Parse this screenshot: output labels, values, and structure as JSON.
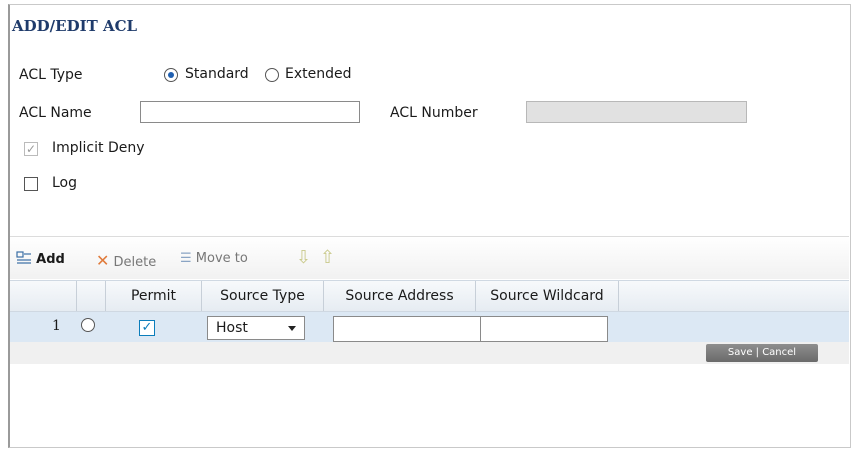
{
  "dialog": {
    "title": "ADD/EDIT ACL",
    "acl_type_label": "ACL Type",
    "type_standard": "Standard",
    "type_extended": "Extended",
    "acl_name_label": "ACL Name",
    "acl_name_value": "",
    "acl_number_label": "ACL Number",
    "acl_number_value": "",
    "implicit_deny_label": "Implicit Deny",
    "log_label": "Log"
  },
  "toolbar": {
    "add": "Add",
    "delete": "Delete",
    "move_to": "Move to"
  },
  "grid": {
    "columns": [
      "Permit",
      "Source Type",
      "Source Address",
      "Source Wildcard"
    ],
    "rows": [
      {
        "index": "1",
        "source_type": "Host",
        "source_address": "",
        "source_wildcard": ""
      }
    ]
  },
  "actions": {
    "save_cancel": "Save | Cancel"
  },
  "colors": {
    "title": "#1f3b6b",
    "row_selected": "#dce8f4",
    "checkbox_accent": "#0b7dbb"
  }
}
